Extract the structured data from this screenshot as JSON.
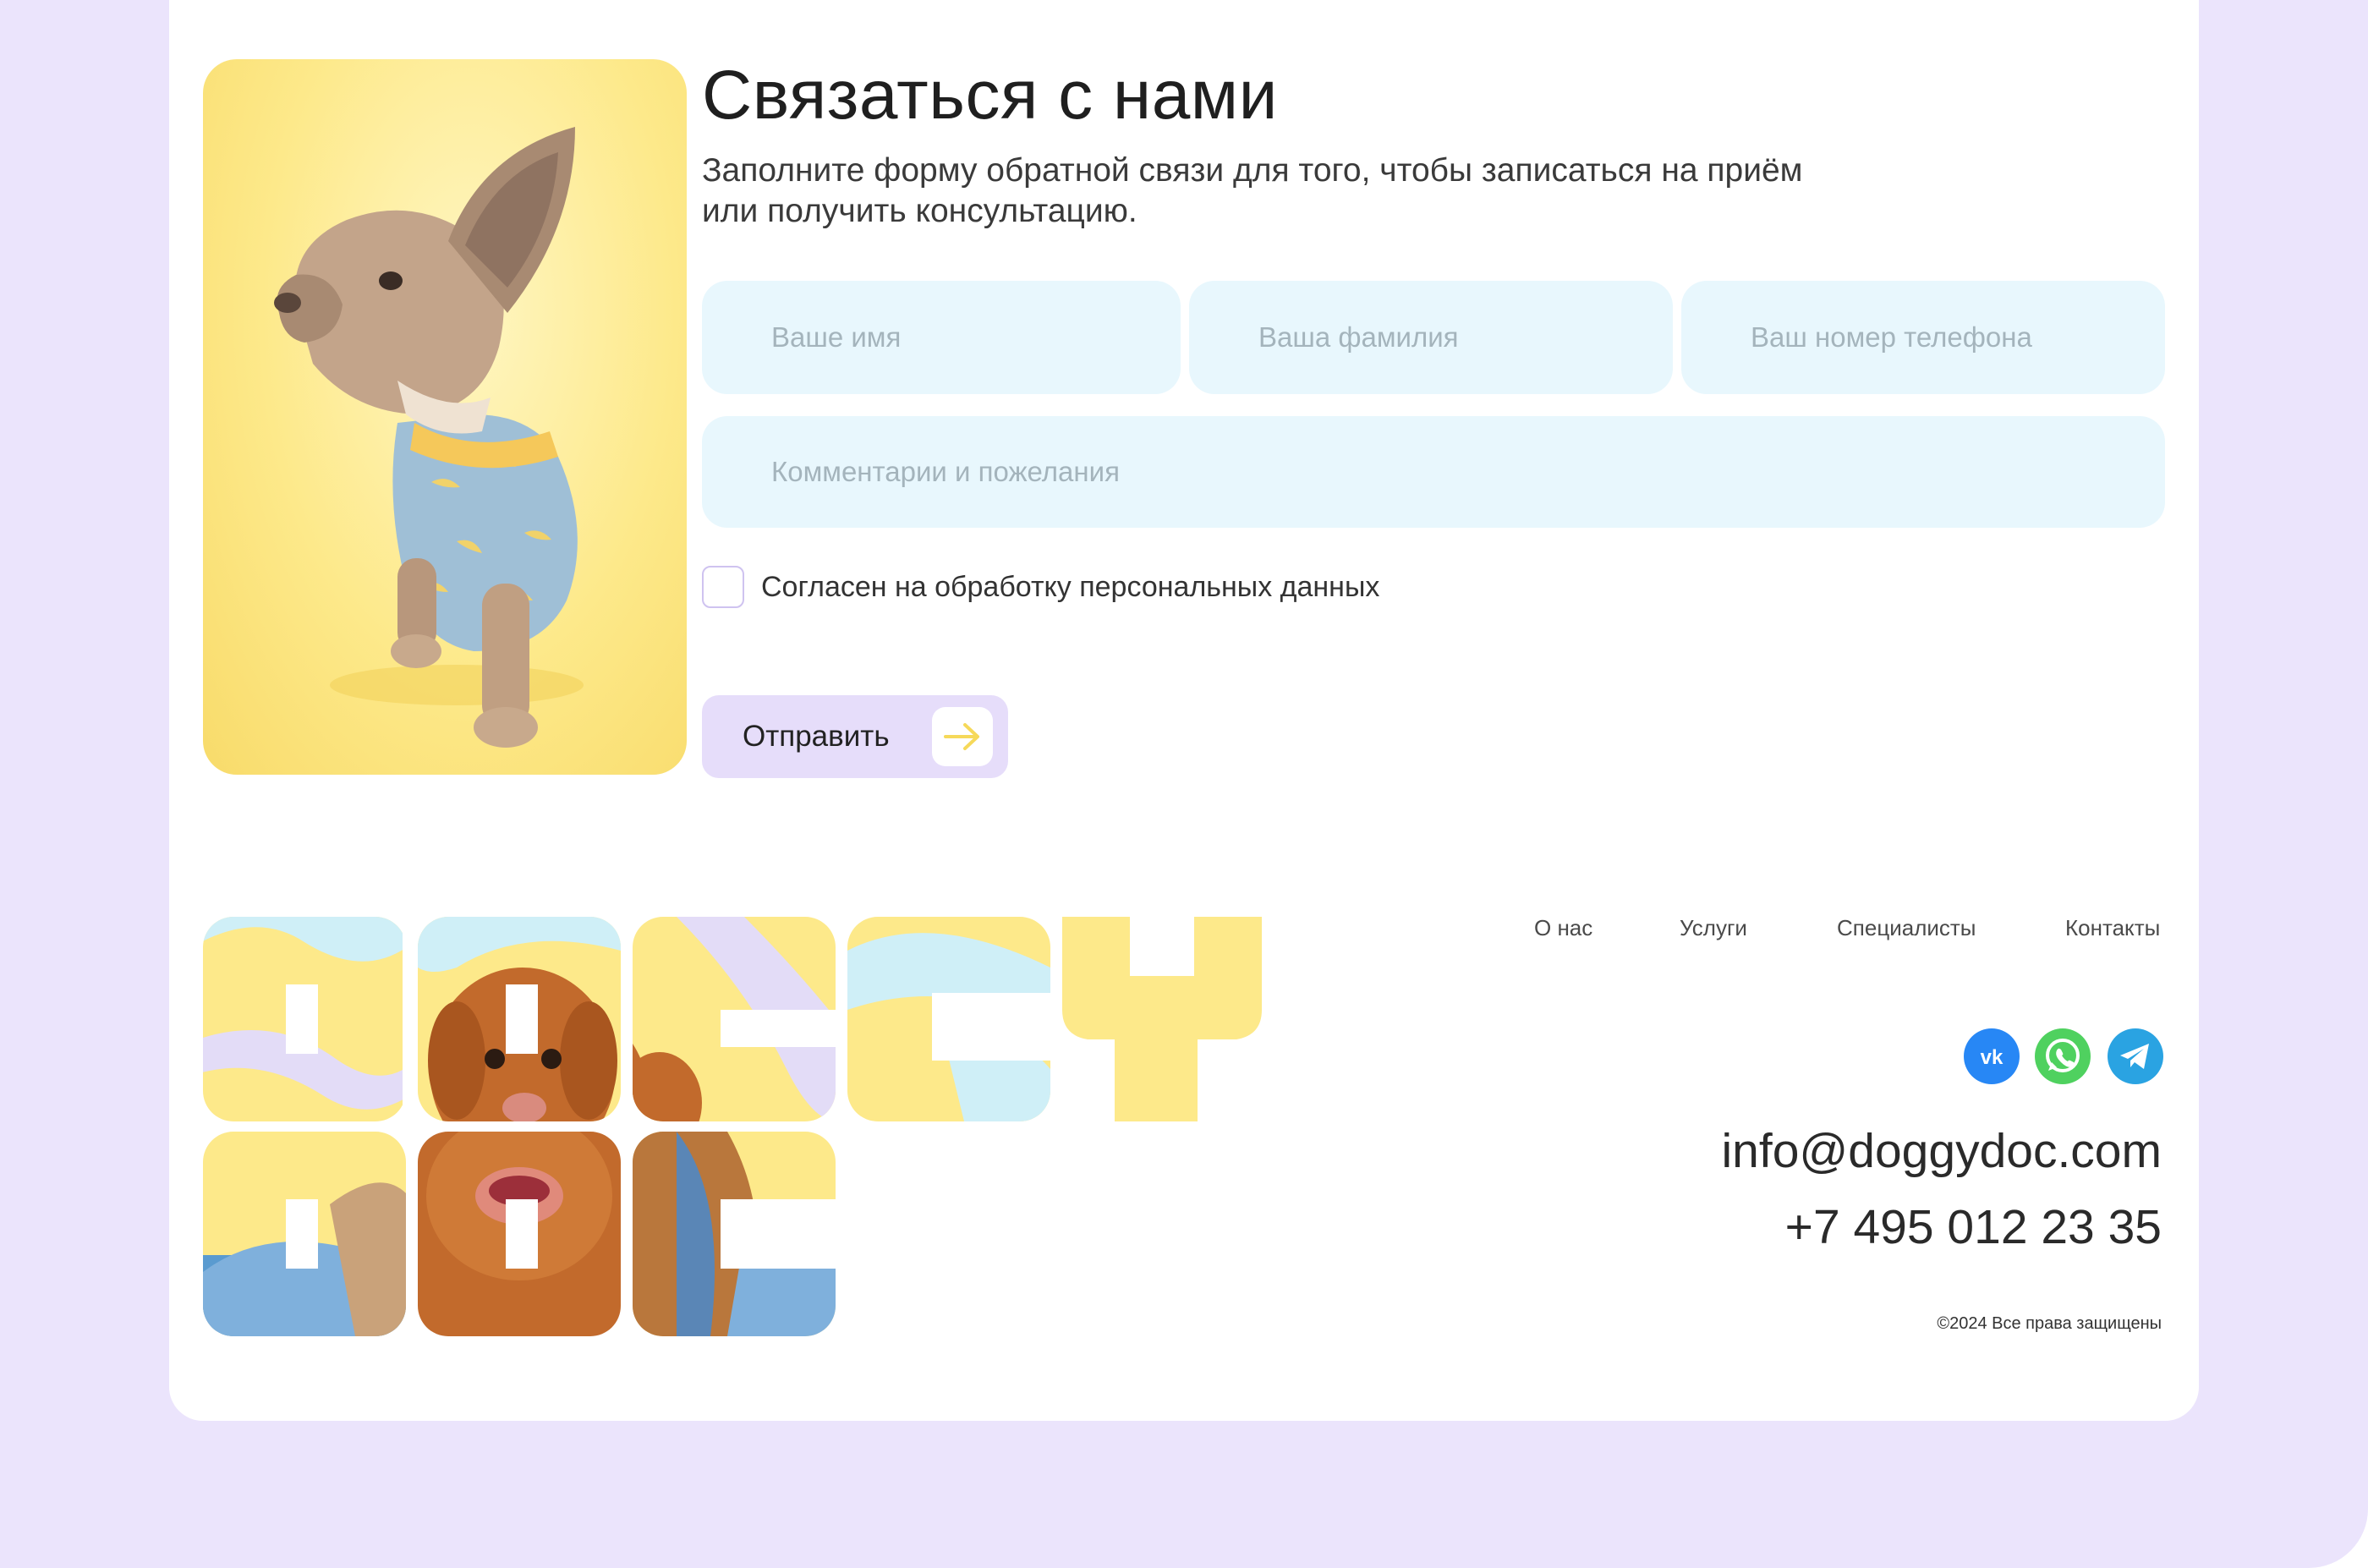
{
  "contact": {
    "title": "Связаться с нами",
    "subtitle_line1": "Заполните форму обратной связи для того, чтобы записаться на приём",
    "subtitle_line2": "или получить консультацию.",
    "fields": {
      "first_name_placeholder": "Ваше имя",
      "last_name_placeholder": "Ваша фамилия",
      "phone_placeholder": "Ваш номер телефона",
      "comment_placeholder": "Комментарии и пожелания"
    },
    "consent_label": "Согласен на обработку персональных данных",
    "consent_checked": false,
    "submit_label": "Отправить"
  },
  "footer": {
    "nav": [
      "О нас",
      "Услуги",
      "Специалисты",
      "Контакты"
    ],
    "social": [
      {
        "icon": "vk-icon",
        "color": "#2787f5"
      },
      {
        "icon": "whatsapp-icon",
        "color": "#4fd15f"
      },
      {
        "icon": "telegram-icon",
        "color": "#2aa3e2"
      }
    ],
    "email": "info@doggydoc.com",
    "phone": "+7 495 012 23 35",
    "copyright": "©2024 Все права защищены"
  },
  "colors": {
    "page_bg": "#ebe4fc",
    "card_bg": "#ffffff",
    "field_bg": "#e8f7fd",
    "button_bg": "#e6ddfa",
    "accent_yellow": "#fde98a",
    "accent_arrow": "#f6d95a"
  }
}
